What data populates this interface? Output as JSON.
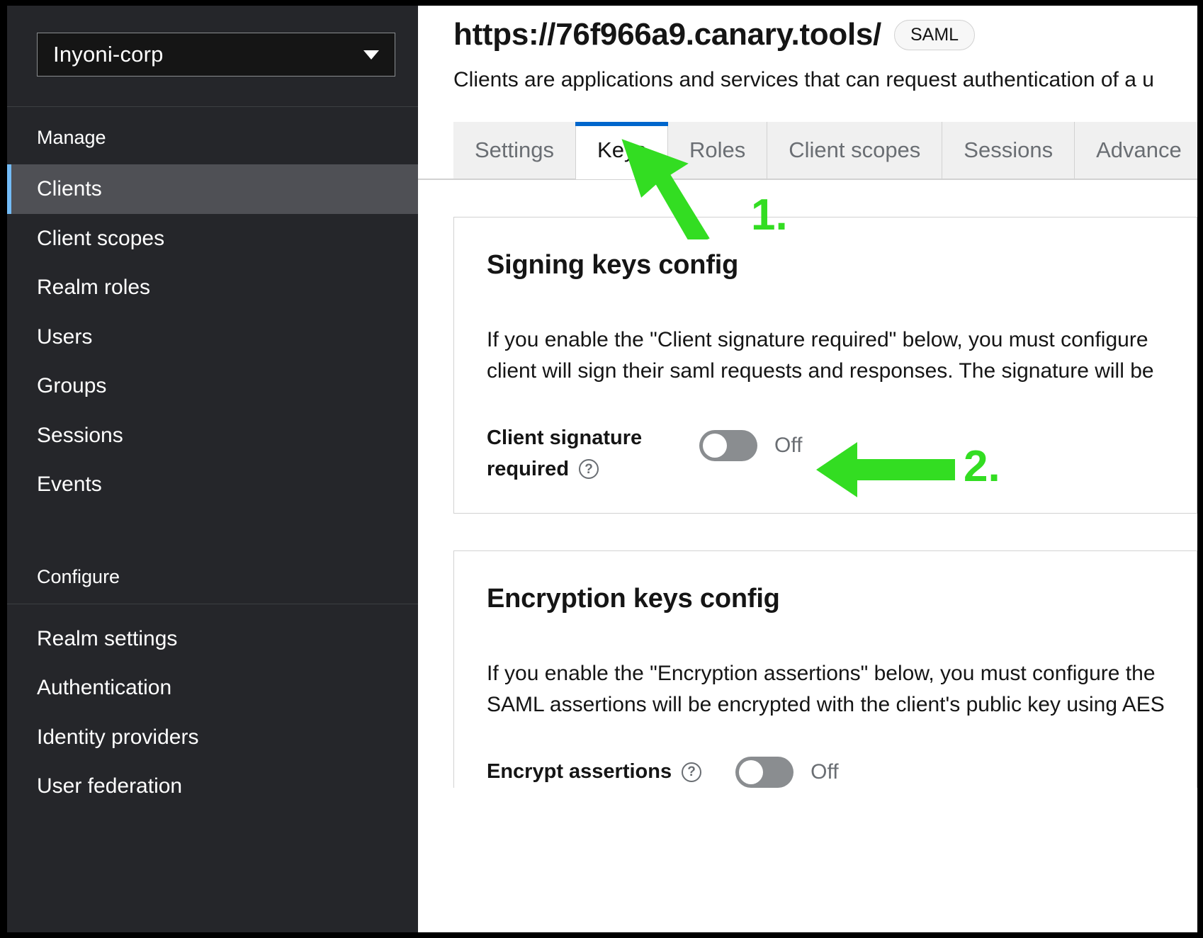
{
  "sidebar": {
    "realm_selector": {
      "value": "Inyoni-corp",
      "caret_icon": "chevron-down-icon"
    },
    "groups": [
      {
        "title": "Manage",
        "items": [
          {
            "label": "Clients",
            "active": true
          },
          {
            "label": "Client scopes",
            "active": false
          },
          {
            "label": "Realm roles",
            "active": false
          },
          {
            "label": "Users",
            "active": false
          },
          {
            "label": "Groups",
            "active": false
          },
          {
            "label": "Sessions",
            "active": false
          },
          {
            "label": "Events",
            "active": false
          }
        ]
      },
      {
        "title": "Configure",
        "items": [
          {
            "label": "Realm settings",
            "active": false
          },
          {
            "label": "Authentication",
            "active": false
          },
          {
            "label": "Identity providers",
            "active": false
          },
          {
            "label": "User federation",
            "active": false
          }
        ]
      }
    ]
  },
  "header": {
    "title": "https://76f966a9.canary.tools/",
    "badge": "SAML",
    "subtitle": "Clients are applications and services that can request authentication of a u"
  },
  "tabs": [
    {
      "label": "Settings",
      "active": false
    },
    {
      "label": "Keys",
      "active": true
    },
    {
      "label": "Roles",
      "active": false
    },
    {
      "label": "Client scopes",
      "active": false
    },
    {
      "label": "Sessions",
      "active": false
    },
    {
      "label": "Advance",
      "active": false
    }
  ],
  "signing_card": {
    "title": "Signing keys config",
    "description_line1": "If you enable the \"Client signature required\" below, you must configure",
    "description_line2": "client will sign their saml requests and responses. The signature will be",
    "field": {
      "label_line1": "Client signature",
      "label_line2": "required",
      "help_icon": "question-circle-icon",
      "toggle_state": "Off",
      "toggle_on": false
    }
  },
  "encryption_card": {
    "title": "Encryption keys config",
    "description_line1": "If you enable the \"Encryption assertions\" below, you must configure the",
    "description_line2": "SAML assertions will be encrypted with the client's public key using AES",
    "field": {
      "label": "Encrypt assertions",
      "help_icon": "question-circle-icon",
      "toggle_state": "Off",
      "toggle_on": false
    }
  },
  "annotations": [
    {
      "number": "1.",
      "target": "keys-tab",
      "color": "#33dd22"
    },
    {
      "number": "2.",
      "target": "client-signature-required-toggle",
      "color": "#33dd22"
    }
  ],
  "colors": {
    "sidebar_bg": "#25262a",
    "sidebar_active_bg": "#4f5055",
    "sidebar_active_accent": "#73bcf7",
    "tab_active_accent": "#0066cc",
    "annotation_green": "#33dd22"
  }
}
